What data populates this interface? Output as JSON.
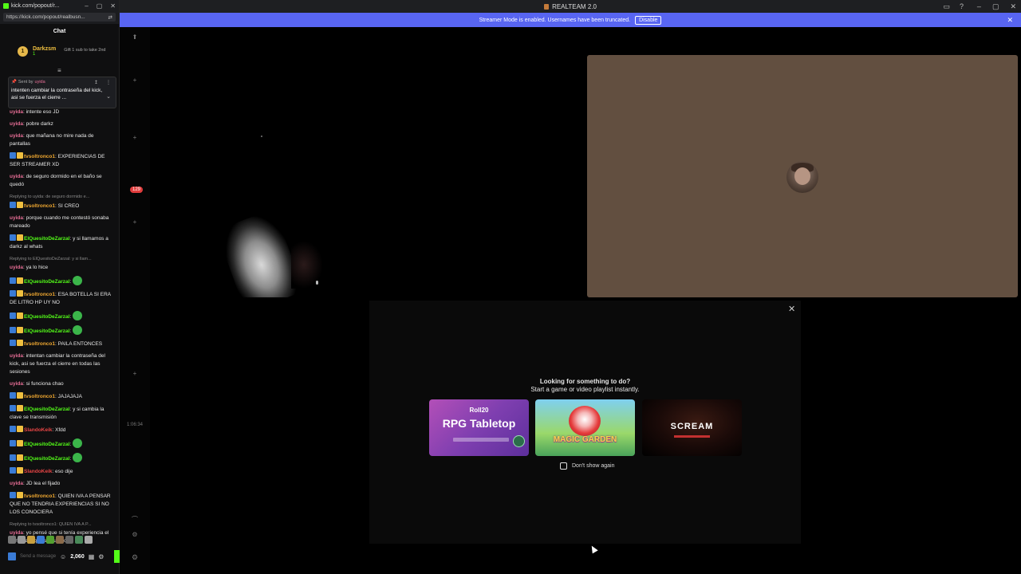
{
  "colors": {
    "banner": "#5865f2",
    "kick_green": "#53fc18",
    "user_tile": "#624f40"
  },
  "main_window": {
    "title": "REALTEAM 2.0",
    "banner_text": "Streamer Mode is enabled. Usernames have been truncated.",
    "banner_button": "Disable",
    "rail_badge": "129",
    "timer": "1:06:34",
    "activity_heading_1": "Looking for something to do?",
    "activity_heading_2": "Start a game or video playlist instantly.",
    "activities": [
      {
        "name": "RPG Tabletop",
        "logo": "Roll20"
      },
      {
        "name": "MAGIC GARDEN"
      },
      {
        "name": "SCREAM"
      }
    ],
    "dont_show": "Don't show again"
  },
  "chat": {
    "window_title": "kick.com/popout/r...",
    "url": "https://kick.com/popout/realbusn...",
    "header": "Chat",
    "gift_leader": {
      "rank": "1",
      "name": "Darkzsm",
      "count": "1",
      "desc": "Gift 1 sub to take 2nd"
    },
    "pinned": {
      "sent_by": "Sent by",
      "user": "uyida",
      "text": "intenten cambiar la contraseña del kick, asi se fuerza el cierre ..."
    },
    "messages": [
      {
        "user": "uyida",
        "color": "#e86e96",
        "text": "intente eso JD"
      },
      {
        "user": "uyida",
        "color": "#e86e96",
        "text": "pobre darkz"
      },
      {
        "user": "uyida",
        "color": "#e86e96",
        "text": "que mañana no mire nada de pantallas"
      },
      {
        "user": "tvsoltronco1",
        "color": "#f0a830",
        "text": "EXPERIENCIAS DE SER STREAMER XD",
        "badges": true
      },
      {
        "user": "uyida",
        "color": "#e86e96",
        "text": "de seguro dormido en el baño se quedó"
      },
      {
        "reply": "Replying to uyida: de seguro dormido e...",
        "user": "tvsoltronco1",
        "color": "#f0a830",
        "text": "SI CREO",
        "badges": true
      },
      {
        "user": "uyida",
        "color": "#e86e96",
        "text": "porque cuando me contestó sonaba mareado"
      },
      {
        "user": "ElQuesitoDeZarzal",
        "color": "#53fc18",
        "text": "y si llamamos a darkz al whats",
        "badges": true
      },
      {
        "reply": "Replying to ElQuesitoDeZarzal: y si llam...",
        "user": "uyida",
        "color": "#e86e96",
        "text": "ya lo hice"
      },
      {
        "user": "ElQuesitoDeZarzal",
        "color": "#53fc18",
        "text": "",
        "badges": true,
        "emote": true
      },
      {
        "user": "tvsoltronco1",
        "color": "#f0a830",
        "text": "ESA BOTELLA SI ERA DE LITRO HP UY NO",
        "badges": true
      },
      {
        "user": "ElQuesitoDeZarzal",
        "color": "#53fc18",
        "text": "",
        "badges": true,
        "emote": true
      },
      {
        "user": "ElQuesitoDeZarzal",
        "color": "#53fc18",
        "text": "",
        "badges": true,
        "emote": true
      },
      {
        "user": "tvsoltronco1",
        "color": "#f0a830",
        "text": "PAILA ENTONCES",
        "badges": true
      },
      {
        "user": "uyida",
        "color": "#e86e96",
        "text": "intentan cambiar la contraseña del kick, asi se fuerza el cierre en todas las sesiones"
      },
      {
        "user": "uyida",
        "color": "#e86e96",
        "text": "si funciona chao"
      },
      {
        "user": "tvsoltronco1",
        "color": "#f0a830",
        "text": "JAJAJAJA",
        "badges": true
      },
      {
        "user": "ElQuesitoDeZarzal",
        "color": "#53fc18",
        "text": "y si cambia la clave se transmisión",
        "badges": true
      },
      {
        "user": "SlandoKeik",
        "color": "#e84545",
        "text": "Xfdd",
        "badges": true
      },
      {
        "user": "ElQuesitoDeZarzal",
        "color": "#53fc18",
        "text": "",
        "badges": true,
        "emote": true
      },
      {
        "user": "ElQuesitoDeZarzal",
        "color": "#53fc18",
        "text": "",
        "badges": true,
        "emote": true
      },
      {
        "user": "SlandoKeik",
        "color": "#e84545",
        "text": "eso dije",
        "badges": true
      },
      {
        "user": "uyida",
        "color": "#e86e96",
        "text": "JD lea el fijado"
      },
      {
        "user": "tvsoltronco1",
        "color": "#f0a830",
        "text": "QUIEN IVA A PENSAR QUE NO TENDRIA EXPERIENCIAS SI NO LOS CONOCIERA",
        "badges": true
      },
      {
        "reply": "Replying to tvsoltronco1: QUIEN IVA A P...",
        "user": "uyida",
        "color": "#e86e96",
        "text": "yo pensé que si tenía experiencia el darkz, aunque sea un poco"
      }
    ],
    "input_placeholder": "Send a message",
    "points": "2,060"
  }
}
